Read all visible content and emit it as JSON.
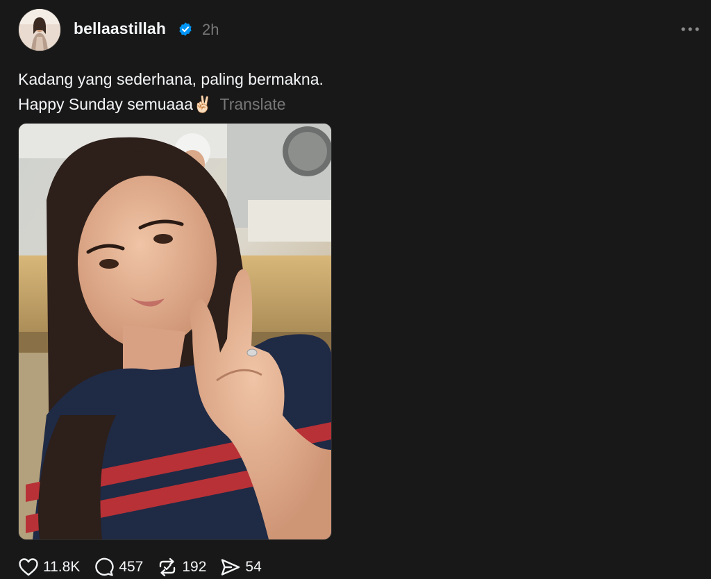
{
  "post": {
    "username": "bellaastillah",
    "time": "2h",
    "caption_line1": "Kadang yang sederhana, paling bermakna.",
    "caption_line2": "Happy Sunday semuaaa",
    "caption_emoji": "✌🏻",
    "translate_label": "Translate"
  },
  "actions": {
    "likes": "11.8K",
    "comments": "457",
    "reposts": "192",
    "shares": "54"
  },
  "icons": {
    "verified": "verified-badge-icon",
    "more": "more-horizontal-icon",
    "like": "heart-icon",
    "comment": "comment-bubble-icon",
    "repost": "repost-icon",
    "share": "send-icon"
  },
  "colors": {
    "background": "#181818",
    "text": "#f3f5f7",
    "muted": "#777777",
    "verified": "#0095f6"
  }
}
